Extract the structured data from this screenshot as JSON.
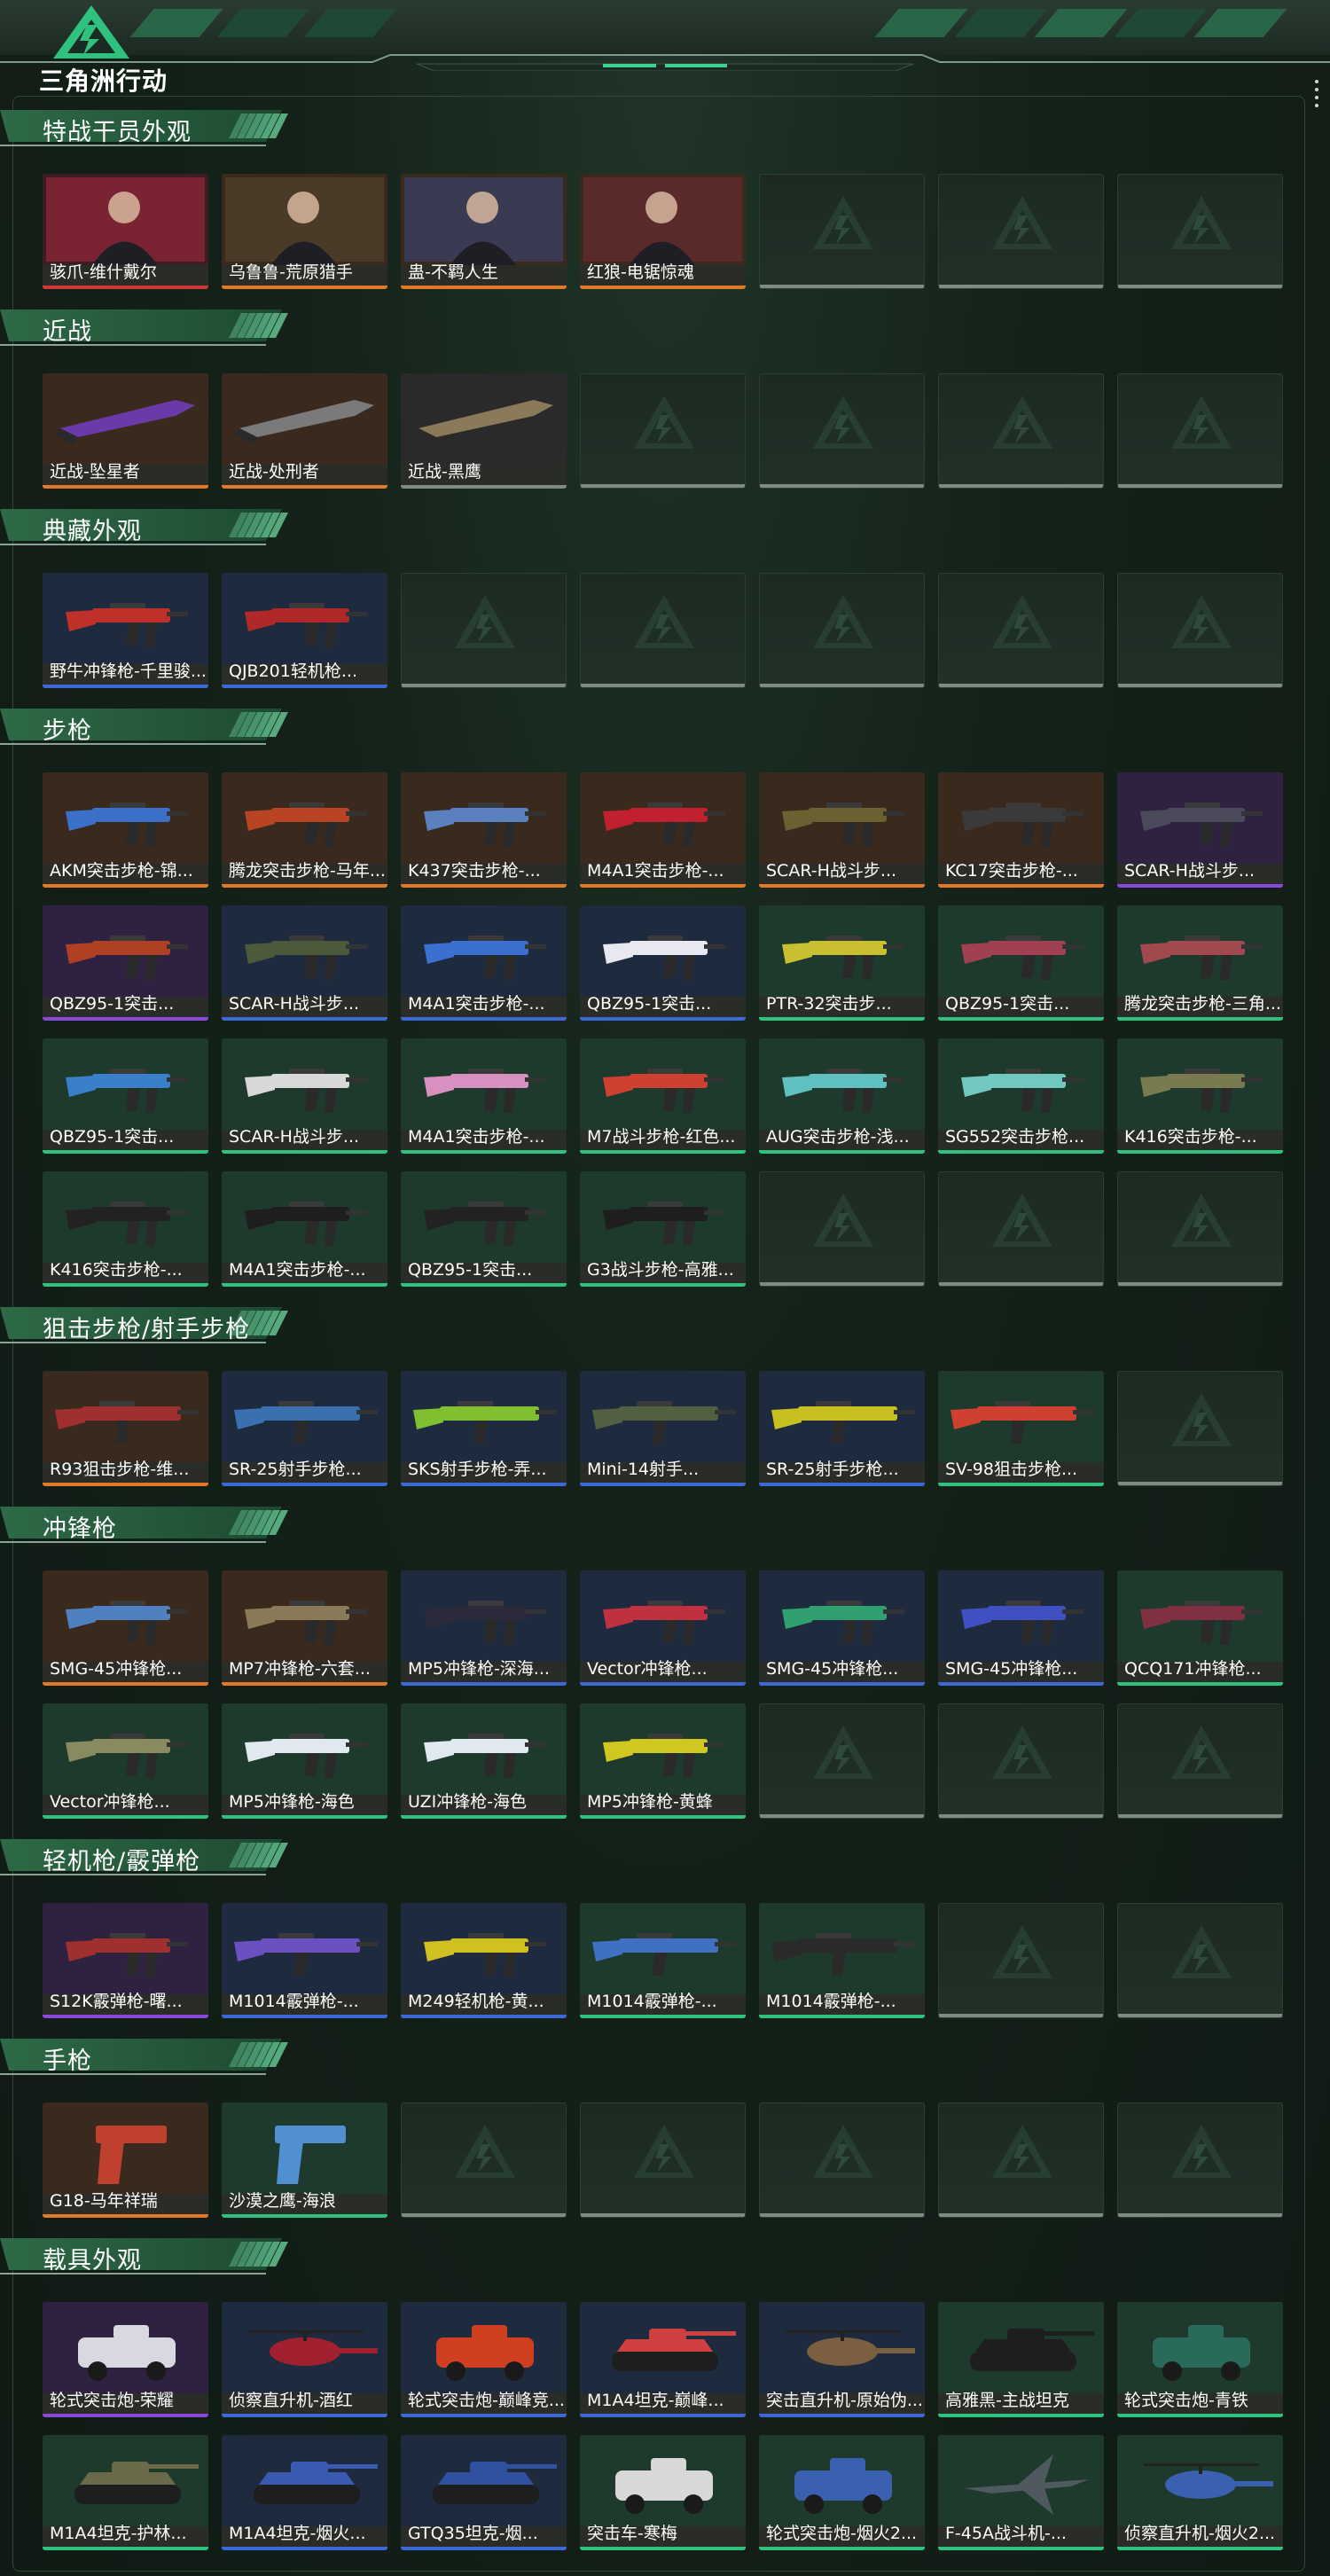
{
  "header": {
    "title": "三角洲行动"
  },
  "colors": {
    "orange": "#e07a26",
    "blue": "#3d68d8",
    "purple": "#8a48d8",
    "green": "#2fc27f",
    "red": "#d03838",
    "gray": "#7f8a85",
    "accent": "#2b8a5a"
  },
  "sections": [
    {
      "title": "特战干员外观",
      "rows": [
        [
          {
            "label": "骇爪-维什戴尔",
            "rarity": "red",
            "kind": "operator",
            "tone": "#7a2433"
          },
          {
            "label": "乌鲁鲁-荒原猎手",
            "rarity": "orange",
            "kind": "operator",
            "tone": "#4a3a28"
          },
          {
            "label": "蛊-不羁人生",
            "rarity": "orange",
            "kind": "operator",
            "tone": "#3a3a52"
          },
          {
            "label": "红狼-电锯惊魂",
            "rarity": "orange",
            "kind": "operator",
            "tone": "#5a2a2a"
          },
          null,
          null,
          null
        ]
      ]
    },
    {
      "title": "近战",
      "rows": [
        [
          {
            "label": "近战-坠星者",
            "rarity": "orange",
            "kind": "knife",
            "tone": "#6a3aa8"
          },
          {
            "label": "近战-处刑者",
            "rarity": "orange",
            "kind": "knife",
            "tone": "#7a7a7a"
          },
          {
            "label": "近战-黑鹰",
            "rarity": "gray",
            "kind": "knife",
            "tone": "#8a7a5a"
          },
          null,
          null,
          null,
          null
        ]
      ]
    },
    {
      "title": "典藏外观",
      "rows": [
        [
          {
            "label": "野牛冲锋枪-千里骏...",
            "rarity": "blue",
            "kind": "gun",
            "tone": "#c0302a"
          },
          {
            "label": "QJB201轻机枪...",
            "rarity": "blue",
            "kind": "gun",
            "tone": "#b02828"
          },
          null,
          null,
          null,
          null,
          null
        ]
      ]
    },
    {
      "title": "步枪",
      "rows": [
        [
          {
            "label": "AKM突击步枪-锦...",
            "rarity": "orange",
            "kind": "gun",
            "tone": "#3a70c8"
          },
          {
            "label": "腾龙突击步枪-马年...",
            "rarity": "orange",
            "kind": "gun",
            "tone": "#b84424"
          },
          {
            "label": "K437突击步枪-...",
            "rarity": "orange",
            "kind": "gun",
            "tone": "#5a80c0"
          },
          {
            "label": "M4A1突击步枪-...",
            "rarity": "orange",
            "kind": "gun",
            "tone": "#c02030"
          },
          {
            "label": "SCAR-H战斗步...",
            "rarity": "orange",
            "kind": "gun",
            "tone": "#6a6030"
          },
          {
            "label": "KC17突击步枪-...",
            "rarity": "orange",
            "kind": "gun",
            "tone": "#3a3a3a"
          },
          {
            "label": "SCAR-H战斗步...",
            "rarity": "purple",
            "kind": "gun",
            "tone": "#4a4a5a"
          }
        ],
        [
          {
            "label": "QBZ95-1突击...",
            "rarity": "purple",
            "kind": "gun",
            "tone": "#b04024"
          },
          {
            "label": "SCAR-H战斗步...",
            "rarity": "blue",
            "kind": "gun",
            "tone": "#4a5a3a"
          },
          {
            "label": "M4A1突击步枪-...",
            "rarity": "blue",
            "kind": "gun",
            "tone": "#3a70d0"
          },
          {
            "label": "QBZ95-1突击...",
            "rarity": "blue",
            "kind": "gun",
            "tone": "#e8e8f0"
          },
          {
            "label": "PTR-32突击步...",
            "rarity": "green",
            "kind": "gun",
            "tone": "#c8c030"
          },
          {
            "label": "QBZ95-1突击...",
            "rarity": "green",
            "kind": "gun",
            "tone": "#a04050"
          },
          {
            "label": "腾龙突击步枪-三角...",
            "rarity": "green",
            "kind": "gun",
            "tone": "#a04a50"
          }
        ],
        [
          {
            "label": "QBZ95-1突击...",
            "rarity": "green",
            "kind": "gun",
            "tone": "#3a80c8"
          },
          {
            "label": "SCAR-H战斗步...",
            "rarity": "green",
            "kind": "gun",
            "tone": "#d8d8d8"
          },
          {
            "label": "M4A1突击步枪-...",
            "rarity": "green",
            "kind": "gun",
            "tone": "#d890c0"
          },
          {
            "label": "M7战斗步枪-红色...",
            "rarity": "green",
            "kind": "gun",
            "tone": "#d04030"
          },
          {
            "label": "AUG突击步枪-浅...",
            "rarity": "green",
            "kind": "gun",
            "tone": "#60c0c0"
          },
          {
            "label": "SG552突击步枪...",
            "rarity": "green",
            "kind": "gun",
            "tone": "#70c8c0"
          },
          {
            "label": "K416突击步枪-...",
            "rarity": "green",
            "kind": "gun",
            "tone": "#7a7a50"
          }
        ],
        [
          {
            "label": "K416突击步枪-...",
            "rarity": "green",
            "kind": "gun",
            "tone": "#222222"
          },
          {
            "label": "M4A1突击步枪-...",
            "rarity": "green",
            "kind": "gun",
            "tone": "#1e1e1e"
          },
          {
            "label": "QBZ95-1突击...",
            "rarity": "green",
            "kind": "gun",
            "tone": "#222222"
          },
          {
            "label": "G3战斗步枪-高雅...",
            "rarity": "green",
            "kind": "gun",
            "tone": "#1e1e1e"
          },
          null,
          null,
          null
        ]
      ]
    },
    {
      "title": "狙击步枪/射手步枪",
      "rows": [
        [
          {
            "label": "R93狙击步枪-维...",
            "rarity": "orange",
            "kind": "rifle",
            "tone": "#a03030"
          },
          {
            "label": "SR-25射手步枪...",
            "rarity": "blue",
            "kind": "rifle",
            "tone": "#3a70b0"
          },
          {
            "label": "SKS射手步枪-弄...",
            "rarity": "blue",
            "kind": "rifle",
            "tone": "#80c030"
          },
          {
            "label": "Mini-14射手...",
            "rarity": "blue",
            "kind": "rifle",
            "tone": "#506040"
          },
          {
            "label": "SR-25射手步枪...",
            "rarity": "blue",
            "kind": "rifle",
            "tone": "#c8c020"
          },
          {
            "label": "SV-98狙击步枪...",
            "rarity": "green",
            "kind": "rifle",
            "tone": "#d04030"
          },
          null
        ]
      ]
    },
    {
      "title": "冲锋枪",
      "rows": [
        [
          {
            "label": "SMG-45冲锋枪...",
            "rarity": "orange",
            "kind": "smg",
            "tone": "#5080c0"
          },
          {
            "label": "MP7冲锋枪-六套...",
            "rarity": "orange",
            "kind": "smg",
            "tone": "#8a7a5a"
          },
          {
            "label": "MP5冲锋枪-深海...",
            "rarity": "blue",
            "kind": "smg",
            "tone": "#2a2a3a"
          },
          {
            "label": "Vector冲锋枪...",
            "rarity": "blue",
            "kind": "smg",
            "tone": "#c03040"
          },
          {
            "label": "SMG-45冲锋枪...",
            "rarity": "blue",
            "kind": "smg",
            "tone": "#30a070"
          },
          {
            "label": "SMG-45冲锋枪...",
            "rarity": "blue",
            "kind": "smg",
            "tone": "#4050c0"
          },
          {
            "label": "QCQ171冲锋枪...",
            "rarity": "green",
            "kind": "smg",
            "tone": "#803040"
          }
        ],
        [
          {
            "label": "Vector冲锋枪...",
            "rarity": "green",
            "kind": "smg",
            "tone": "#8a8a60"
          },
          {
            "label": "MP5冲锋枪-海色",
            "rarity": "green",
            "kind": "smg",
            "tone": "#e0e8f0"
          },
          {
            "label": "UZI冲锋枪-海色",
            "rarity": "green",
            "kind": "smg",
            "tone": "#e0e8f0"
          },
          {
            "label": "MP5冲锋枪-黄蜂",
            "rarity": "green",
            "kind": "smg",
            "tone": "#d0c820"
          },
          null,
          null,
          null
        ]
      ]
    },
    {
      "title": "轻机枪/霰弹枪",
      "rows": [
        [
          {
            "label": "S12K霰弹枪-曙...",
            "rarity": "purple",
            "kind": "gun",
            "tone": "#a03030"
          },
          {
            "label": "M1014霰弹枪-...",
            "rarity": "blue",
            "kind": "shotgun",
            "tone": "#6a50c0"
          },
          {
            "label": "M249轻机枪-黄...",
            "rarity": "blue",
            "kind": "gun",
            "tone": "#d0c020"
          },
          {
            "label": "M1014霰弹枪-...",
            "rarity": "green",
            "kind": "shotgun",
            "tone": "#4070c0"
          },
          {
            "label": "M1014霰弹枪-...",
            "rarity": "green",
            "kind": "shotgun",
            "tone": "#2a2a2a"
          },
          null,
          null
        ]
      ]
    },
    {
      "title": "手枪",
      "rows": [
        [
          {
            "label": "G18-马年祥瑞",
            "rarity": "orange",
            "kind": "pistol",
            "tone": "#c04030"
          },
          {
            "label": "沙漠之鹰-海浪",
            "rarity": "green",
            "kind": "pistol",
            "tone": "#5090d0"
          },
          null,
          null,
          null,
          null,
          null
        ]
      ]
    },
    {
      "title": "载具外观",
      "rows": [
        [
          {
            "label": "轮式突击炮-荣耀",
            "rarity": "purple",
            "kind": "vehicle",
            "tone": "#d8d8e0"
          },
          {
            "label": "侦察直升机-酒红",
            "rarity": "blue",
            "kind": "heli",
            "tone": "#a02030"
          },
          {
            "label": "轮式突击炮-巅峰竞...",
            "rarity": "blue",
            "kind": "vehicle",
            "tone": "#d04020"
          },
          {
            "label": "M1A4坦克-巅峰...",
            "rarity": "blue",
            "kind": "tank",
            "tone": "#d04040"
          },
          {
            "label": "突击直升机-原始伪...",
            "rarity": "blue",
            "kind": "heli",
            "tone": "#7a6040"
          },
          {
            "label": "高雅黑-主战坦克",
            "rarity": "green",
            "kind": "tank",
            "tone": "#1e1e1e"
          },
          {
            "label": "轮式突击炮-青铁",
            "rarity": "green",
            "kind": "vehicle",
            "tone": "#2a6a5a"
          }
        ],
        [
          {
            "label": "M1A4坦克-护林...",
            "rarity": "green",
            "kind": "tank",
            "tone": "#6a6a4a"
          },
          {
            "label": "M1A4坦克-烟火...",
            "rarity": "blue",
            "kind": "tank",
            "tone": "#3a5ab0"
          },
          {
            "label": "GTQ35坦克-烟...",
            "rarity": "blue",
            "kind": "tank",
            "tone": "#3050a0"
          },
          {
            "label": "突击车-寒梅",
            "rarity": "green",
            "kind": "vehicle",
            "tone": "#d8d8d8"
          },
          {
            "label": "轮式突击炮-烟火2...",
            "rarity": "green",
            "kind": "vehicle",
            "tone": "#3a60b0"
          },
          {
            "label": "F-45A战斗机-...",
            "rarity": "green",
            "kind": "jet",
            "tone": "#505860"
          },
          {
            "label": "侦察直升机-烟火2...",
            "rarity": "green",
            "kind": "heli",
            "tone": "#3a60b0"
          }
        ]
      ]
    }
  ]
}
